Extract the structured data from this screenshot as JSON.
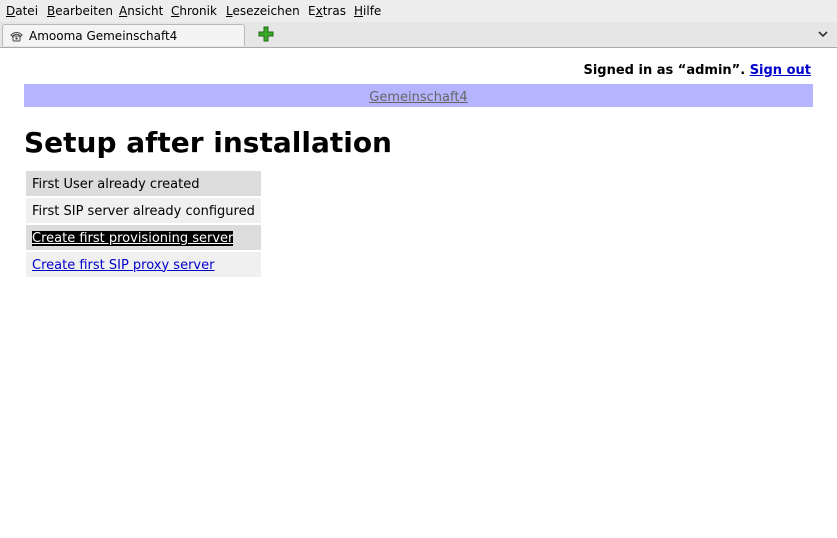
{
  "menu": [
    {
      "accel": "D",
      "rest": "atei"
    },
    {
      "accel": "B",
      "rest": "earbeiten"
    },
    {
      "accel": "A",
      "rest": "nsicht"
    },
    {
      "accel": "C",
      "rest": "hronik"
    },
    {
      "accel": "L",
      "rest": "esezeichen"
    },
    {
      "pre": "E",
      "accel": "x",
      "rest": "tras"
    },
    {
      "accel": "H",
      "rest": "ilfe"
    }
  ],
  "tab": {
    "title": "Amooma Gemeinschaft4",
    "icon": "phone-icon"
  },
  "header": {
    "signed_in_text": "Signed in as “admin”.",
    "sign_out_label": "Sign out"
  },
  "nav": {
    "label": "Gemeinschaft4"
  },
  "page": {
    "title": "Setup after installation"
  },
  "setup_steps": [
    {
      "text": "First User already created",
      "link": false
    },
    {
      "text": "First SIP server already configured",
      "link": false
    },
    {
      "text": "Create first provisioning server",
      "link": true,
      "selected": true
    },
    {
      "text": "Create first SIP proxy server",
      "link": true,
      "selected": false
    }
  ],
  "colors": {
    "nav_bg": "#b4b4ff",
    "link": "#0000cc",
    "menu_bg": "#ededed"
  }
}
